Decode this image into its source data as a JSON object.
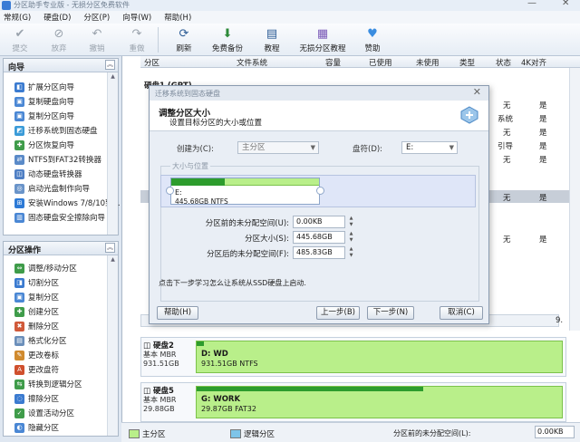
{
  "window": {
    "title": "分区助手专业版 - 无损分区免费软件"
  },
  "menu": [
    "常规(G)",
    "硬盘(D)",
    "分区(P)",
    "向导(W)",
    "帮助(H)"
  ],
  "toolbar": [
    {
      "label": "提交",
      "icon": "check-icon",
      "enabled": false
    },
    {
      "label": "放弃",
      "icon": "discard-icon",
      "enabled": false
    },
    {
      "label": "撤销",
      "icon": "undo-icon",
      "enabled": false
    },
    {
      "label": "重做",
      "icon": "redo-icon",
      "enabled": false
    },
    {
      "label": "刷新",
      "icon": "refresh-icon",
      "enabled": true
    },
    {
      "label": "免费备份",
      "icon": "backup-icon",
      "enabled": true
    },
    {
      "label": "教程",
      "icon": "book-icon",
      "enabled": true
    },
    {
      "label": "无损分区教程",
      "icon": "tutorial-icon",
      "enabled": true
    },
    {
      "label": "赞助",
      "icon": "heart-icon",
      "enabled": true
    }
  ],
  "wizard_panel": {
    "title": "向导",
    "items": [
      "扩展分区向导",
      "复制硬盘向导",
      "复制分区向导",
      "迁移系统到固态硬盘",
      "分区恢复向导",
      "NTFS到FAT32转换器",
      "动态硬盘转换器",
      "启动光盘制作向导",
      "安装Windows 7/8/10到...",
      "固态硬盘安全擦除向导"
    ]
  },
  "ops_panel": {
    "title": "分区操作",
    "items": [
      "调整/移动分区",
      "切割分区",
      "复制分区",
      "创建分区",
      "删除分区",
      "格式化分区",
      "更改卷标",
      "更改盘符",
      "转换到逻辑分区",
      "擦除分区",
      "设置活动分区",
      "隐藏分区"
    ]
  },
  "table": {
    "headers": [
      "分区",
      "文件系统",
      "容量",
      "已使用",
      "未使用",
      "类型",
      "状态",
      "4K对齐"
    ],
    "disk1_label": "硬盘1 (GPT)",
    "rows": [
      {
        "status": "无",
        "align": "是"
      },
      {
        "status": "系统",
        "align": "是"
      },
      {
        "status": "无",
        "align": "是"
      },
      {
        "status": "引导",
        "align": "是"
      },
      {
        "status": "无",
        "align": "是"
      },
      {
        "status": "无",
        "align": "是"
      },
      {
        "status": "无",
        "align": "是"
      }
    ],
    "side_value": "9."
  },
  "disks": [
    {
      "name": "硬盘2",
      "type": "基本 MBR",
      "size": "931.51GB",
      "part_name": "D: WD",
      "part_size": "931.51GB NTFS",
      "used_pct": 0.02
    },
    {
      "name": "硬盘5",
      "type": "基本 MBR",
      "size": "29.88GB",
      "part_name": "G: WORK",
      "part_size": "29.87GB FAT32",
      "used_pct": 0.62
    }
  ],
  "legend": {
    "primary": "主分区",
    "logical": "逻辑分区",
    "status_label": "分区前的未分配空间(L):",
    "status_value": "0.00KB"
  },
  "dialog": {
    "title": "迁移系统到固态硬盘",
    "heading": "调整分区大小",
    "subheading": "设置目标分区的大小或位置",
    "create_as_label": "创建为(C):",
    "create_as_value": "主分区",
    "drive_letter_label": "盘符(D):",
    "drive_letter_value": "E:",
    "group_label": "大小与位置",
    "partition_name": "E:",
    "partition_size": "445.68GB NTFS",
    "used_pct": 0.36,
    "fields": [
      {
        "label": "分区前的未分配空间(U):",
        "value": "0.00KB"
      },
      {
        "label": "分区大小(S):",
        "value": "445.68GB"
      },
      {
        "label": "分区后的未分配空间(F):",
        "value": "485.83GB"
      }
    ],
    "hint": "点击下一步学习怎么让系统从SSD硬盘上启动.",
    "buttons": {
      "help": "帮助(H)",
      "back": "上一步(B)",
      "next": "下一步(N)",
      "cancel": "取消(C)"
    }
  }
}
